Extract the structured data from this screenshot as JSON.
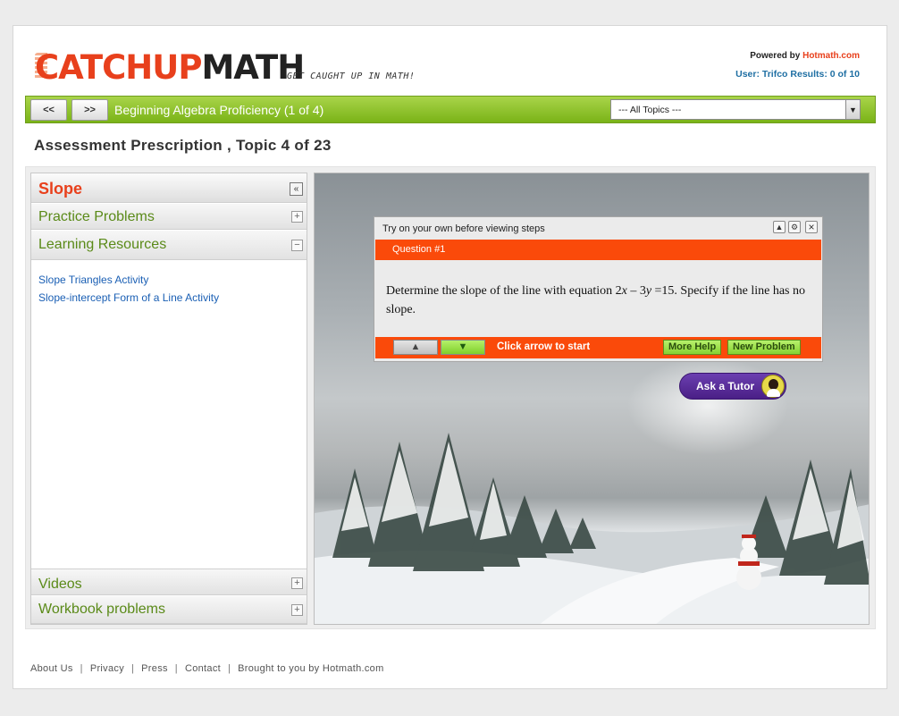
{
  "header": {
    "logo_part1": "CATCHUP",
    "logo_part2": "MATH",
    "tagline": "GET CAUGHT UP IN MATH!",
    "powered_by": "Powered by ",
    "powered_brand": "Hotmath.com",
    "user_line": "User: Trifco Results: 0 of 10"
  },
  "navbar": {
    "prev_label": "<<",
    "next_label": ">>",
    "course_title": "Beginning Algebra Proficiency (1 of 4)",
    "topic_select": "--- All Topics ---"
  },
  "page_heading": "Assessment Prescription , Topic 4 of 23",
  "left_panel": {
    "title": "Slope",
    "sections": {
      "practice": "Practice Problems",
      "learning": "Learning Resources",
      "videos": "Videos",
      "workbook": "Workbook problems"
    },
    "resources": [
      "Slope Triangles Activity",
      "Slope-intercept Form of a Line Activity"
    ]
  },
  "widget": {
    "title": "Try on your own  before viewing steps",
    "question_label": "Question #1",
    "question_pre": "Determine the slope of the line with equation 2",
    "question_x": "x",
    "question_mid": " – 3",
    "question_y": "y",
    "question_post": " =15. Specify if the line has no slope.",
    "start_text": "Click arrow to start",
    "more_help": "More Help",
    "new_problem": "New Problem"
  },
  "tutor": {
    "label": "Ask a Tutor"
  },
  "footer": {
    "links": [
      "About Us",
      "Privacy",
      "Press",
      "Contact",
      "Brought to you by Hotmath.com"
    ],
    "separator": "|"
  },
  "colors": {
    "brand_orange": "#e8401c",
    "nav_green": "#7ab317",
    "section_green": "#5a8a18",
    "link_blue": "#1a5fb4",
    "tutor_purple": "#4a1f86"
  },
  "icons": [
    "collapse-left-icon",
    "expand-plus-icon",
    "collapse-minus-icon",
    "arrow-up-icon",
    "arrow-down-icon",
    "options-icon",
    "close-icon",
    "dropdown-arrow-icon",
    "tutor-avatar-icon"
  ]
}
